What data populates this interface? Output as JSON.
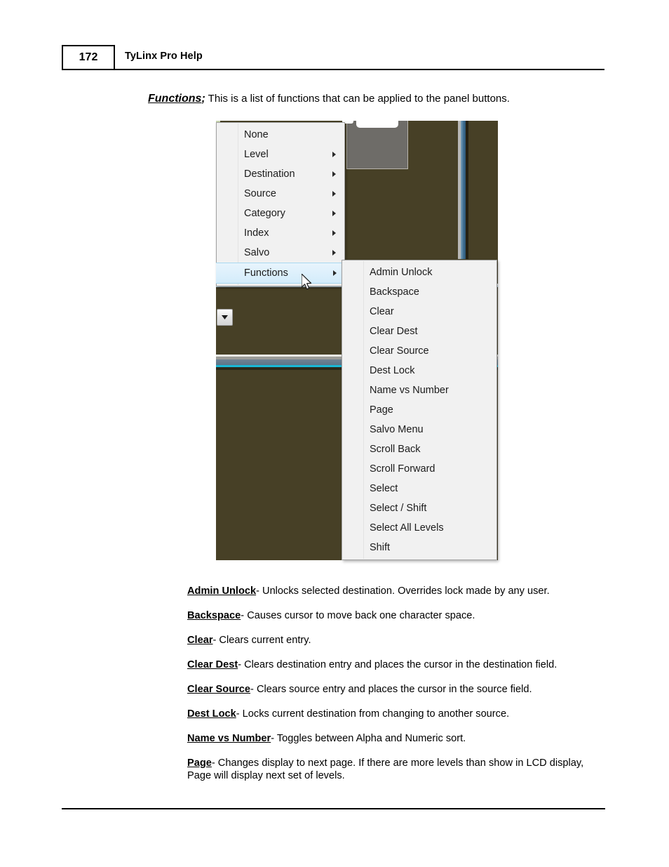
{
  "header": {
    "page_number": "172",
    "title": "TyLinx Pro Help"
  },
  "intro": {
    "term": "Functions",
    "punct": ";",
    "text": " This is a list of functions that can be applied to the panel buttons."
  },
  "figure": {
    "colors": {
      "background_olive": "#474026",
      "gray_panel": "#6e6c68",
      "accent_cyan": "#19b8d6",
      "scrollbar_blue": "#3d6e92",
      "menu_background": "#f1f1f1",
      "menu_highlight": "#d3ecfb"
    },
    "main_menu": {
      "name": "context-menu",
      "items": [
        {
          "label": "None",
          "has_submenu": false,
          "selected": false
        },
        {
          "label": "Level",
          "has_submenu": true,
          "selected": false
        },
        {
          "label": "Destination",
          "has_submenu": true,
          "selected": false
        },
        {
          "label": "Source",
          "has_submenu": true,
          "selected": false
        },
        {
          "label": "Category",
          "has_submenu": true,
          "selected": false
        },
        {
          "label": "Index",
          "has_submenu": true,
          "selected": false
        },
        {
          "label": "Salvo",
          "has_submenu": true,
          "selected": false
        },
        {
          "label": "Functions",
          "has_submenu": true,
          "selected": true
        }
      ]
    },
    "submenu": {
      "name": "functions-submenu",
      "items": [
        {
          "label": "Admin Unlock"
        },
        {
          "label": "Backspace"
        },
        {
          "label": "Clear"
        },
        {
          "label": "Clear Dest"
        },
        {
          "label": "Clear Source"
        },
        {
          "label": "Dest Lock"
        },
        {
          "label": "Name vs Number"
        },
        {
          "label": "Page"
        },
        {
          "label": "Salvo Menu"
        },
        {
          "label": "Scroll Back"
        },
        {
          "label": "Scroll Forward"
        },
        {
          "label": "Select"
        },
        {
          "label": "Select / Shift"
        },
        {
          "label": "Select All Levels"
        },
        {
          "label": "Shift"
        }
      ]
    },
    "dropdown_button": "chevron-down"
  },
  "definitions": [
    {
      "term": "Admin Unlock",
      "desc": "- Unlocks selected destination. Overrides lock made by any user."
    },
    {
      "term": "Backspace",
      "desc": "- Causes cursor to move back one character space."
    },
    {
      "term": "Clear",
      "desc": "- Clears current entry."
    },
    {
      "term": "Clear Dest",
      "desc": "- Clears destination entry and places the cursor in the destination field."
    },
    {
      "term": "Clear Source",
      "desc": "- Clears source entry and places the cursor in the source field."
    },
    {
      "term": "Dest Lock",
      "desc": "- Locks current destination from changing to another source."
    },
    {
      "term": "Name vs Number",
      "desc": "- Toggles between Alpha and Numeric sort."
    },
    {
      "term": "Page",
      "desc": "- Changes display to next page. If there are more levels than show in LCD display, Page will display next set of levels."
    }
  ]
}
